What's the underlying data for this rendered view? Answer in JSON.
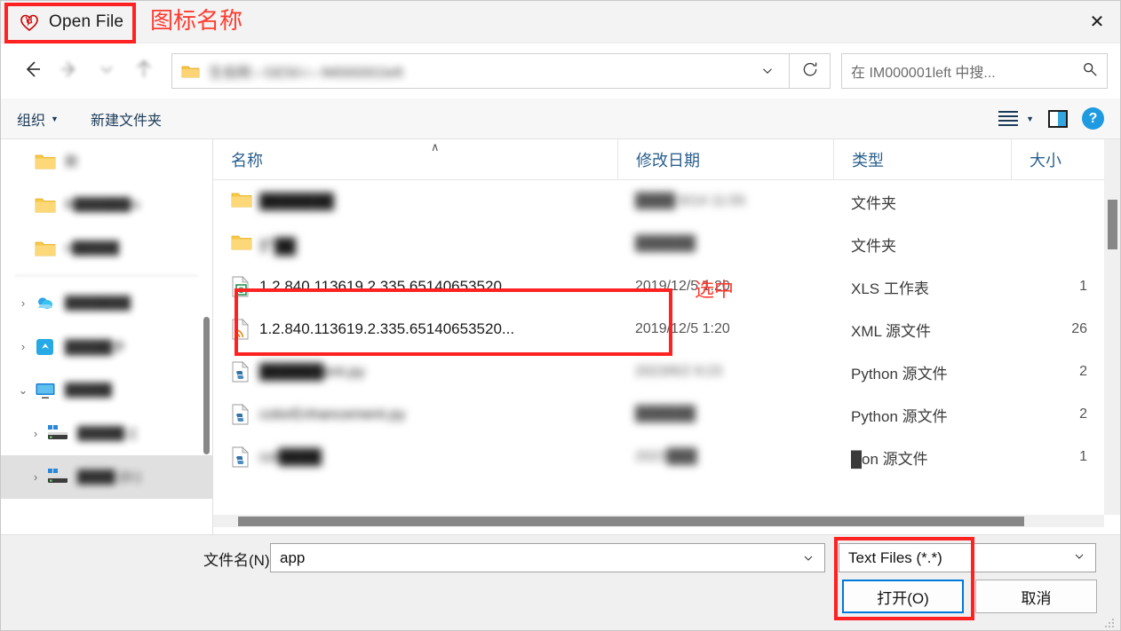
{
  "window": {
    "title": "Open File",
    "app_icon": "heart-icon",
    "close_label": "✕"
  },
  "annotations": [
    {
      "id": "icon-name",
      "text": "图标名称",
      "color": "#ff3b30"
    },
    {
      "id": "selected",
      "text": "选中",
      "color": "#ff3b30"
    }
  ],
  "nav": {
    "back_icon": "arrow-left-icon",
    "forward_icon": "arrow-right-icon",
    "recent_icon": "chevron-down-icon",
    "up_icon": "arrow-up-icon",
    "address_path": "生伯刚 › GE50-i › IM000001left",
    "address_folder_icon": "folder-icon",
    "address_dropdown_icon": "chevron-down-icon",
    "refresh_icon": "refresh-icon",
    "search_placeholder": "在 IM000001left 中搜...",
    "search_icon": "search-icon"
  },
  "toolbar": {
    "organize_label": "组织",
    "new_folder_label": "新建文件夹",
    "view_icon": "list-view-icon",
    "preview_pane_icon": "preview-pane-icon",
    "help_icon": "help-icon",
    "help_label": "?"
  },
  "sidebar": {
    "items": [
      {
        "label": "款",
        "icon": "folder-icon",
        "chevron": "",
        "selected": false
      },
      {
        "label": "B██████is",
        "icon": "folder-icon",
        "chevron": "",
        "selected": false
      },
      {
        "label": "n█████",
        "icon": "folder-icon",
        "chevron": "",
        "selected": false
      },
      {
        "label": "███████",
        "icon": "onedrive-icon",
        "chevron": "›",
        "selected": false
      },
      {
        "label": "█████步",
        "icon": "sync-app-icon",
        "chevron": "›",
        "selected": false
      },
      {
        "label": "█████",
        "icon": "monitor-icon",
        "chevron": "⌄",
        "selected": false
      },
      {
        "label": "█████ ((",
        "icon": "disk-icon",
        "chevron": "›",
        "selected": false
      },
      {
        "label": "████ (D:)",
        "icon": "disk-icon",
        "chevron": "›",
        "selected": true
      }
    ]
  },
  "filelist": {
    "columns": [
      {
        "key": "name",
        "label": "名称"
      },
      {
        "key": "date",
        "label": "修改日期"
      },
      {
        "key": "type",
        "label": "类型"
      },
      {
        "key": "size",
        "label": "大小"
      }
    ],
    "sort_indicator": "∧",
    "rows": [
      {
        "name": "███████",
        "name_blur": true,
        "date": "████ 6/14 11:55",
        "date_blur": true,
        "type": "文件夹",
        "size": "",
        "icon": "folder-icon",
        "selected": false
      },
      {
        "name": "扩██",
        "name_blur": true,
        "date": "██████",
        "date_blur": true,
        "type": "文件夹",
        "size": "",
        "icon": "folder-icon",
        "selected": false
      },
      {
        "name": "1.2.840.113619.2.335.65140653520...",
        "name_blur": false,
        "date": "2019/12/5 1:20",
        "date_blur": false,
        "type": "XLS 工作表",
        "size": "1",
        "icon": "xls-icon",
        "selected": true
      },
      {
        "name": "1.2.840.113619.2.335.65140653520...",
        "name_blur": false,
        "date": "2019/12/5 1:20",
        "date_blur": false,
        "type": "XML 源文件",
        "size": "26",
        "icon": "xml-icon",
        "selected": true
      },
      {
        "name": "██████ent.py",
        "name_blur": true,
        "date": "2023/6/2 9:23",
        "date_blur": true,
        "type": "Python 源文件",
        "size": "2",
        "icon": "python-icon",
        "selected": false
      },
      {
        "name": "colorEnhancement.py",
        "name_blur": true,
        "date": "██████",
        "date_blur": true,
        "type": "Python 源文件",
        "size": "2",
        "icon": "python-icon",
        "selected": false
      },
      {
        "name": "col████",
        "name_blur": true,
        "date": "2023███",
        "date_blur": true,
        "type": "█on 源文件",
        "size": "1",
        "icon": "python-icon",
        "selected": false
      }
    ]
  },
  "footer": {
    "filename_label": "文件名(N):",
    "filename_value": "app",
    "filename_dropdown_icon": "chevron-down-icon",
    "filter_value": "Text Files (*.*)",
    "filter_dropdown_icon": "chevron-down-icon",
    "open_label": "打开(O)",
    "cancel_label": "取消"
  },
  "colors": {
    "accent_blue": "#0078d7",
    "annotation_red": "#ff2222",
    "header_blue": "#2a5f8f",
    "selection_gray": "#e0e0e0"
  }
}
